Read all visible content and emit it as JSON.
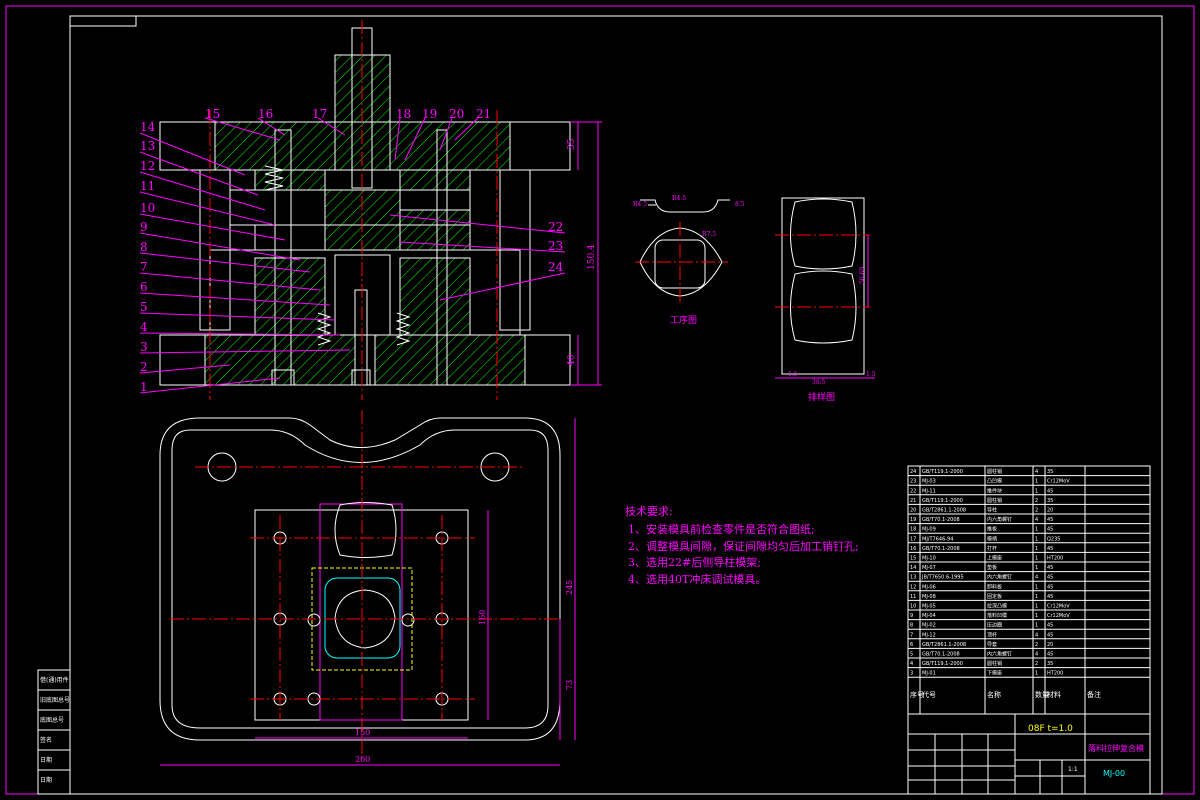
{
  "part_numbers_left": [
    "14",
    "13",
    "12",
    "11",
    "10",
    "9",
    "8",
    "7",
    "6",
    "5",
    "4",
    "3",
    "2",
    "1"
  ],
  "part_numbers_top": [
    "15",
    "16",
    "17",
    "18",
    "19",
    "20",
    "21"
  ],
  "part_numbers_right": [
    "22",
    "23",
    "24"
  ],
  "dims": {
    "height_top": "35",
    "height_total": "150.4",
    "height_bottom": "40",
    "plan_width_outer": "200",
    "plan_width_inner": "150",
    "plan_height_outer": "245",
    "plan_height_inner": "160",
    "plan_height_lower": "73",
    "part_r_left": "R4.5",
    "part_r_top": "R4.5",
    "part_side": "8.5",
    "part_arc": "R7.5",
    "strip_pitch": "56.69",
    "strip_left": "1.5",
    "strip_width": "38.5",
    "strip_right": "1.5"
  },
  "labels": {
    "process_view": "工序图",
    "strip_layout": "排样图"
  },
  "tech_requirements": {
    "title": "技术要求:",
    "items": [
      "1、安装模具前检查零件是否符合图纸;",
      "2、调整模具间隙，保证间隙均匀后加工销钉孔;",
      "3、选用22#后侧导柱模架;",
      "4、选用40T冲床调试模具。"
    ]
  },
  "bom_rows": [
    {
      "no": "24",
      "code": "GB/T119.1-2000",
      "name": "圆柱销",
      "qty": "4",
      "mat": "35"
    },
    {
      "no": "23",
      "code": "MJ-03",
      "name": "凸凹模",
      "qty": "1",
      "mat": "Cr12MoV"
    },
    {
      "no": "22",
      "code": "MJ-11",
      "name": "推件块",
      "qty": "1",
      "mat": "45"
    },
    {
      "no": "21",
      "code": "GB/T119.1-2000",
      "name": "圆柱销",
      "qty": "2",
      "mat": "35"
    },
    {
      "no": "20",
      "code": "GB/T2861.1-2008",
      "name": "导柱",
      "qty": "2",
      "mat": "20"
    },
    {
      "no": "19",
      "code": "GB/T70.1-2008",
      "name": "内六角螺钉",
      "qty": "4",
      "mat": "45"
    },
    {
      "no": "18",
      "code": "MJ-09",
      "name": "推板",
      "qty": "1",
      "mat": "45"
    },
    {
      "no": "17",
      "code": "MJ/T7646-94",
      "name": "模柄",
      "qty": "1",
      "mat": "Q235"
    },
    {
      "no": "16",
      "code": "GB/T70.1-2008",
      "name": "打杆",
      "qty": "1",
      "mat": "45"
    },
    {
      "no": "15",
      "code": "MJ-10",
      "name": "上模座",
      "qty": "1",
      "mat": "HT200"
    },
    {
      "no": "14",
      "code": "MJ-07",
      "name": "垫板",
      "qty": "1",
      "mat": "45"
    },
    {
      "no": "13",
      "code": "JB/T7650.6-1995",
      "name": "内六角螺钉",
      "qty": "4",
      "mat": "45"
    },
    {
      "no": "12",
      "code": "MJ-06",
      "name": "卸料板",
      "qty": "1",
      "mat": "45"
    },
    {
      "no": "11",
      "code": "MJ-08",
      "name": "固定板",
      "qty": "1",
      "mat": "45"
    },
    {
      "no": "10",
      "code": "MJ-05",
      "name": "拉深凸模",
      "qty": "1",
      "mat": "Cr12MoV"
    },
    {
      "no": "9",
      "code": "MJ-04",
      "name": "落料凹模",
      "qty": "1",
      "mat": "Cr12MoV"
    },
    {
      "no": "8",
      "code": "MJ-02",
      "name": "压边圈",
      "qty": "1",
      "mat": "45"
    },
    {
      "no": "7",
      "code": "MJ-12",
      "name": "顶杆",
      "qty": "4",
      "mat": "45"
    },
    {
      "no": "6",
      "code": "GB/T2861.1-2008",
      "name": "导套",
      "qty": "2",
      "mat": "20"
    },
    {
      "no": "5",
      "code": "GB/T70.1-2008",
      "name": "内六角螺钉",
      "qty": "4",
      "mat": "45"
    },
    {
      "no": "4",
      "code": "GB/T119.1-2000",
      "name": "圆柱销",
      "qty": "2",
      "mat": "35"
    },
    {
      "no": "3",
      "code": "MJ-01",
      "name": "下模座",
      "qty": "1",
      "mat": "HT200"
    }
  ],
  "bom_header": {
    "no": "序号",
    "code": "代号",
    "name": "名称",
    "qty": "数量",
    "mat": "材料",
    "note": "备注"
  },
  "title_block": {
    "scale_note": "08F t=1.0",
    "drawing_name": "落料拉伸复合模",
    "drawing_no": "MJ-00",
    "scale": "1:1"
  },
  "left_strip": [
    "借(通)用件",
    "旧底图总号",
    "底图总号",
    "签名",
    "日期",
    "日期"
  ]
}
